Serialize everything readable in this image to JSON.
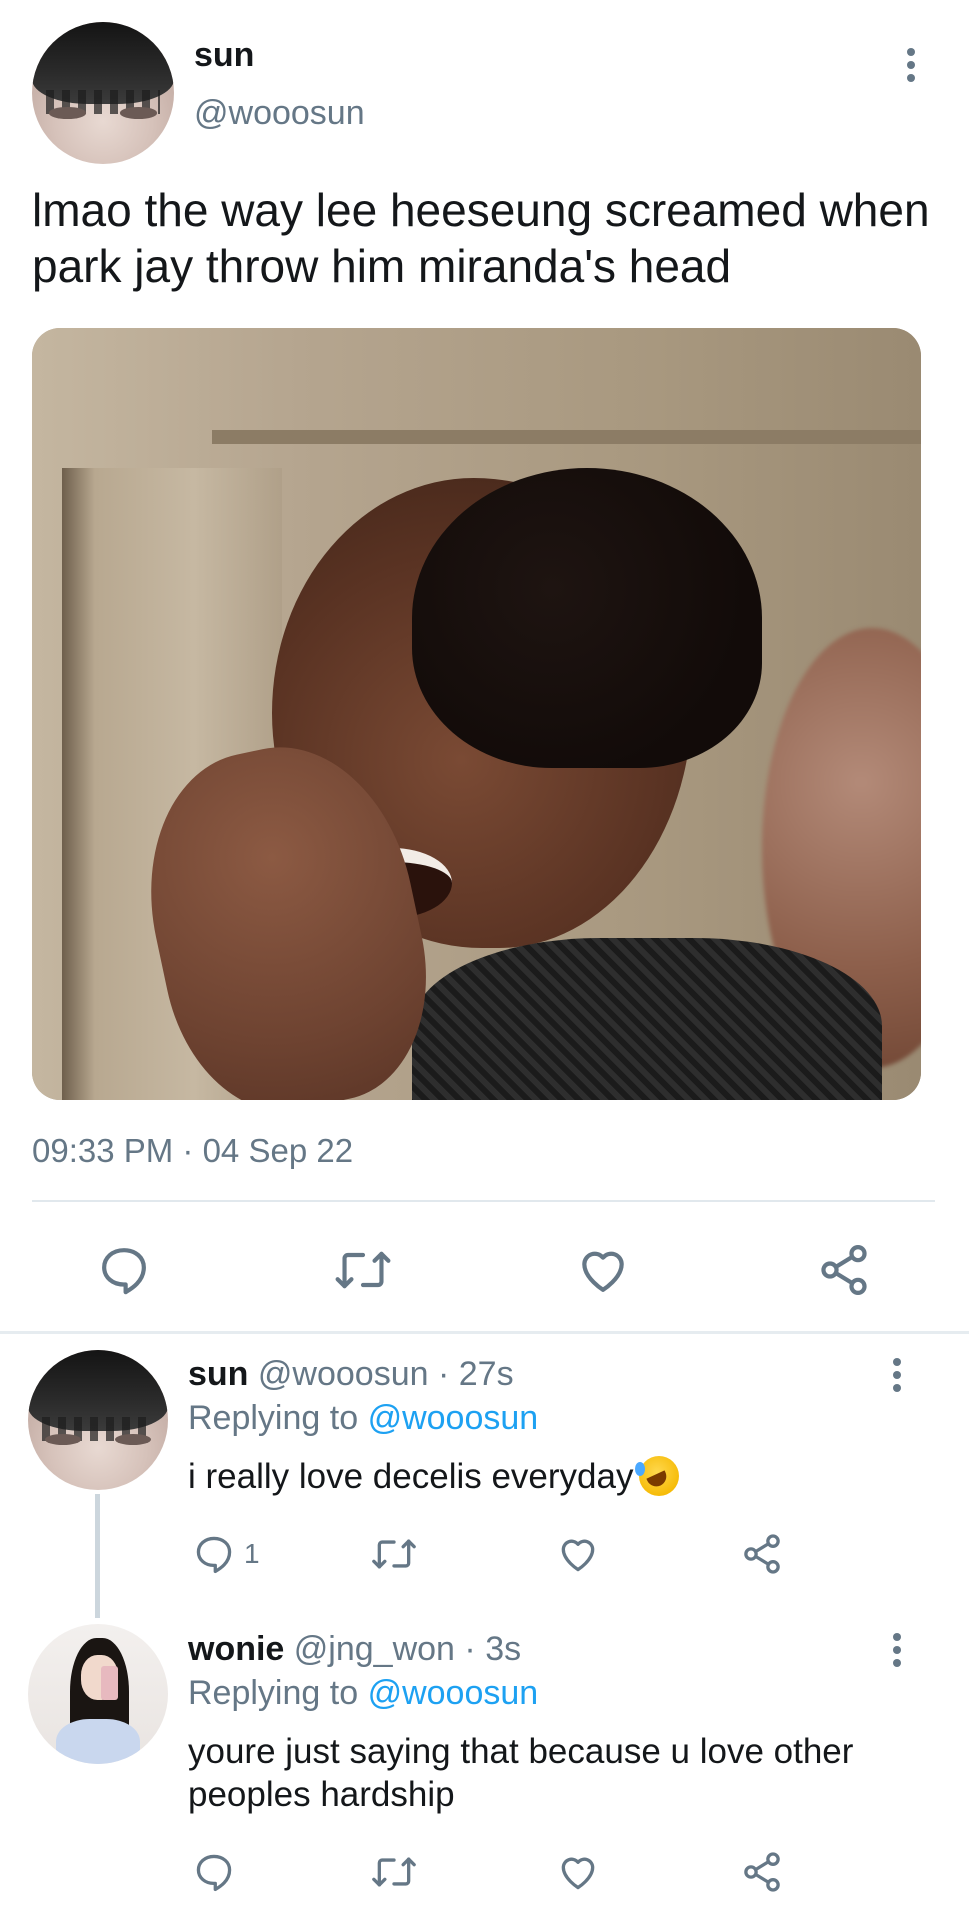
{
  "main_tweet": {
    "author_name": "sun",
    "author_handle": "@wooosun",
    "text": "lmao the way lee heeseung screamed when park jay throw him miranda's head",
    "timestamp": "09:33 PM · 04 Sep 22",
    "menu_icon": "more-vertical-icon"
  },
  "actions": {
    "reply_icon": "reply-icon",
    "retweet_icon": "retweet-icon",
    "like_icon": "heart-icon",
    "share_icon": "share-icon"
  },
  "replies": [
    {
      "author_name": "sun",
      "author_handle": "@wooosun",
      "age": "· 27s",
      "replying_prefix": "Replying to",
      "replying_to": "@wooosun",
      "text": "i really love decelis everyday",
      "emoji": "rolling-on-floor-laughing",
      "reply_count": "1"
    },
    {
      "author_name": "wonie",
      "author_handle": "@jng_won",
      "age": "· 3s",
      "replying_prefix": "Replying to",
      "replying_to": "@wooosun",
      "text": "youre just saying that because u love other peoples hardship",
      "reply_count": ""
    }
  ],
  "colors": {
    "text_primary": "#14171a",
    "text_secondary": "#657786",
    "link": "#1da1f2",
    "divider": "#e1e8ed"
  }
}
